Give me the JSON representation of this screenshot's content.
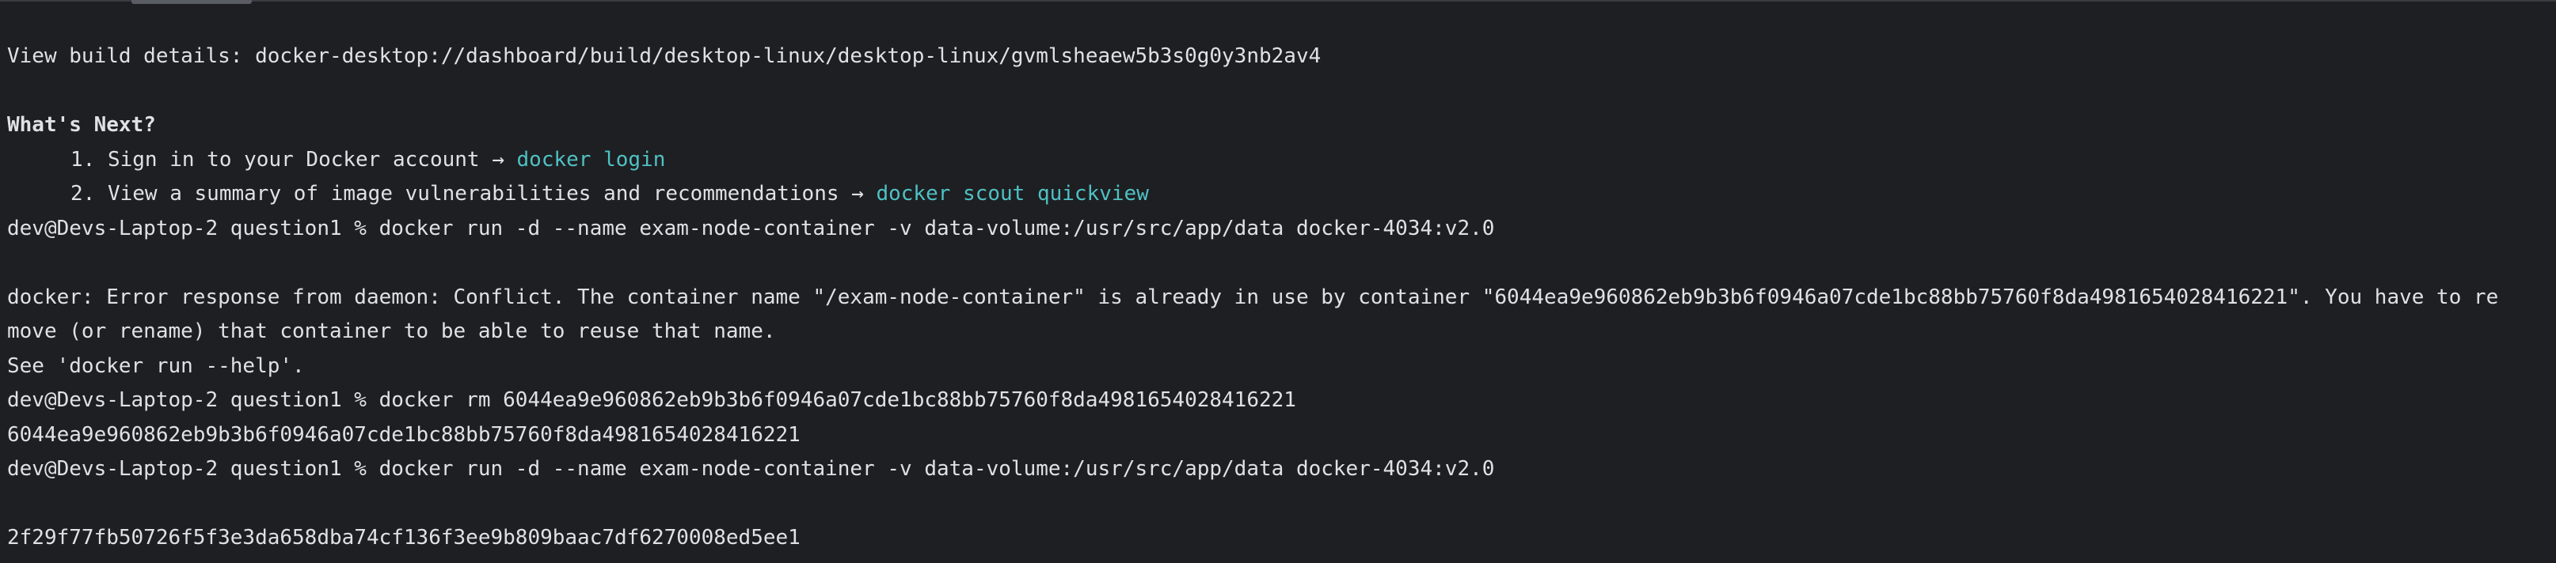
{
  "terminal": {
    "build_details": "View build details: docker-desktop://dashboard/build/desktop-linux/desktop-linux/gvmlsheaew5b3s0g0y3nb2av4",
    "whats_next_heading": "What's Next?",
    "next_step_1": {
      "text": "1. Sign in to your Docker account → ",
      "link": "docker login"
    },
    "next_step_2": {
      "text": "2. View a summary of image vulnerabilities and recommendations → ",
      "link": "docker scout quickview"
    },
    "cmd_run_1": "dev@Devs-Laptop-2 question1 % docker run -d --name exam-node-container -v data-volume:/usr/src/app/data docker-4034:v2.0",
    "error_line_1": "docker: Error response from daemon: Conflict. The container name \"/exam-node-container\" is already in use by container \"6044ea9e960862eb9b3b6f0946a07cde1bc88bb75760f8da4981654028416221\". You have to re",
    "error_line_2": "move (or rename) that container to be able to reuse that name.",
    "error_line_3": "See 'docker run --help'.",
    "cmd_rm": "dev@Devs-Laptop-2 question1 % docker rm 6044ea9e960862eb9b3b6f0946a07cde1bc88bb75760f8da4981654028416221",
    "rm_output": "6044ea9e960862eb9b3b6f0946a07cde1bc88bb75760f8da4981654028416221",
    "cmd_run_2": "dev@Devs-Laptop-2 question1 % docker run -d --name exam-node-container -v data-volume:/usr/src/app/data docker-4034:v2.0",
    "container_id": "2f29f77fb50726f5f3e3da658dba74cf136f3ee9b809baac7df6270008ed5ee1"
  },
  "colors": {
    "background": "#1e1f22",
    "text": "#dfe1e5",
    "link": "#4fc1c4"
  }
}
